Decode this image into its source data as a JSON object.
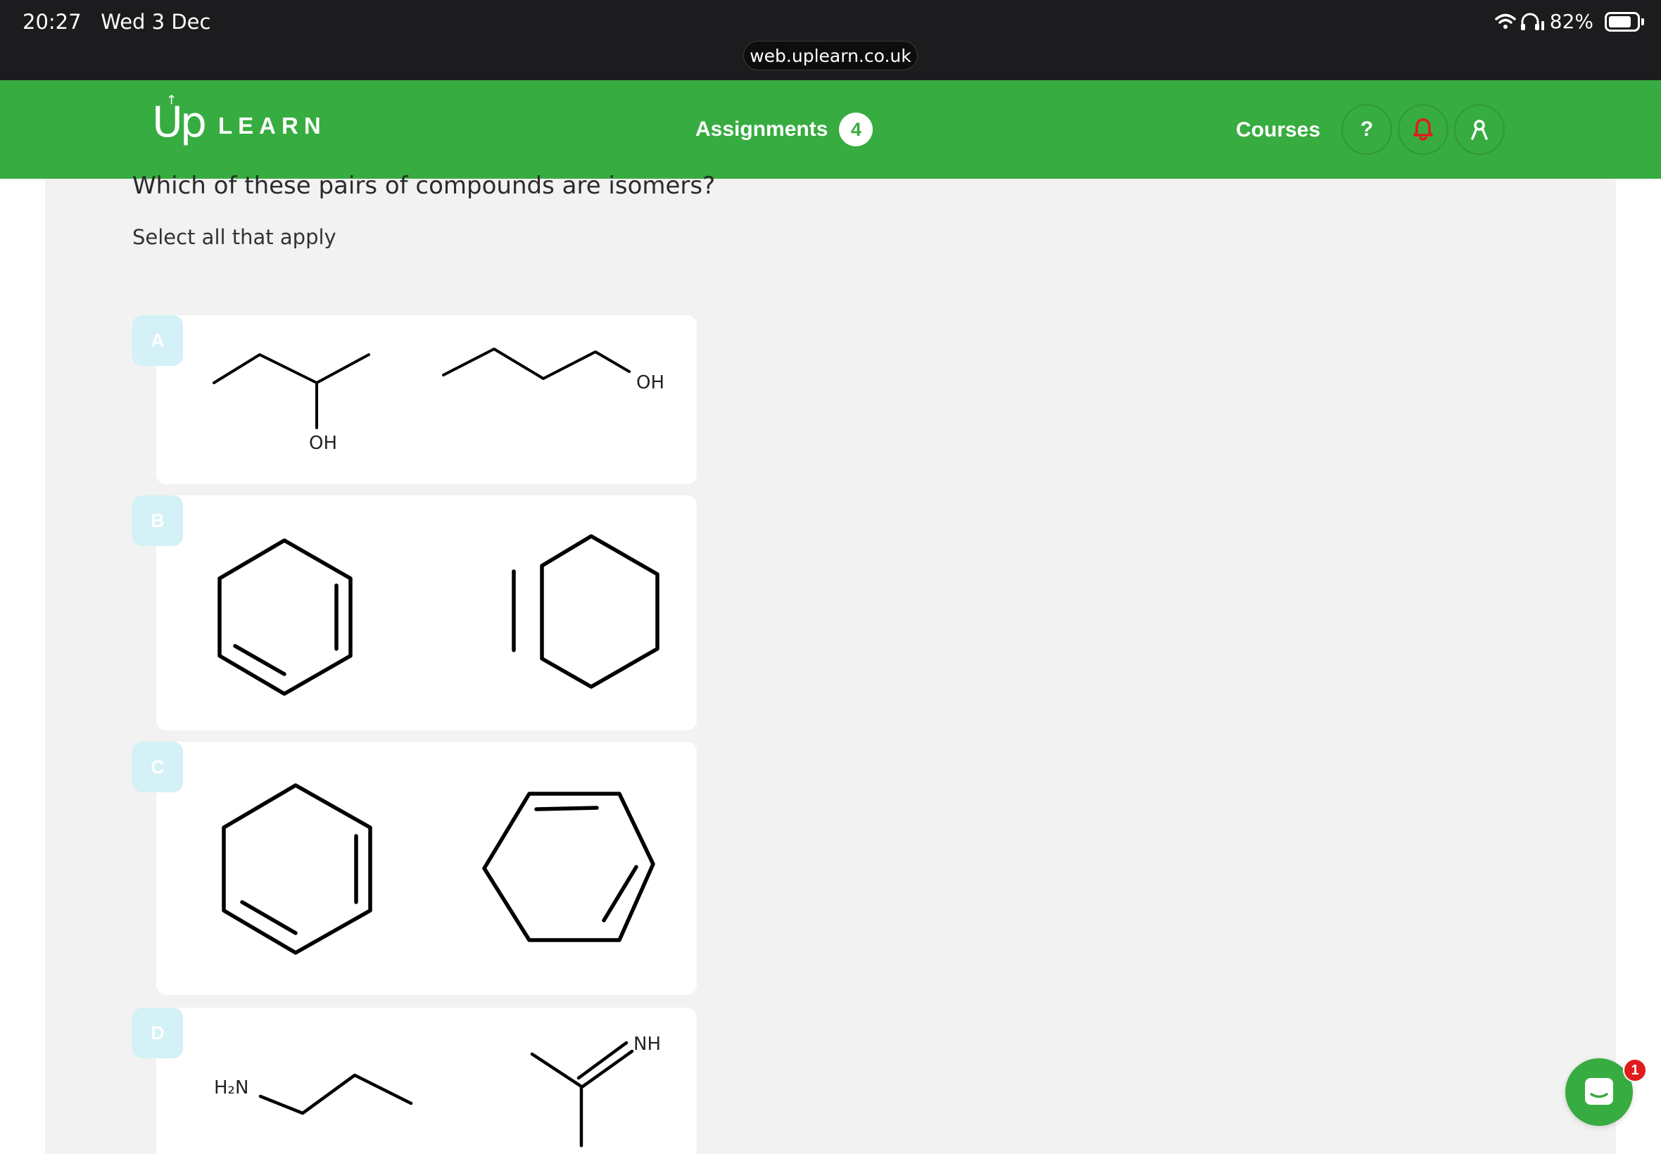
{
  "status_bar": {
    "time": "20:27",
    "date": "Wed 3 Dec",
    "battery": "82%",
    "battery_level": 0.82,
    "url": "web.uplearn.co.uk"
  },
  "header": {
    "logo_up": "Up",
    "logo_learn": "LEARN",
    "assignments_label": "Assignments",
    "assignments_count": "4",
    "courses_label": "Courses",
    "help_label": "?",
    "accent_color": "#37ac40",
    "icons": [
      "help-icon",
      "bell-icon",
      "user-icon"
    ]
  },
  "question": {
    "text": "Which of these pairs of compounds are isomers?",
    "instruction": "Select all that apply",
    "options": [
      {
        "letter": "A",
        "label_1": "OH",
        "label_2": "OH"
      },
      {
        "letter": "B"
      },
      {
        "letter": "C"
      },
      {
        "letter": "D",
        "label_1": "H₂N",
        "label_2": "NH"
      }
    ]
  },
  "chat": {
    "badge_count": "1"
  }
}
